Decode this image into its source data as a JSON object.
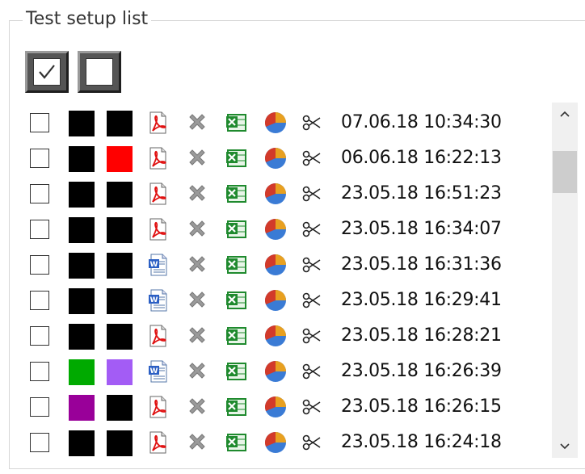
{
  "group": {
    "title": "Test setup list"
  },
  "toolbar": {
    "check_all": {
      "icon": "checkmark-icon"
    },
    "uncheck_all": {
      "icon": "empty-box-icon"
    }
  },
  "colors": {
    "black": "#000000",
    "red": "#ff0000",
    "green": "#00aa00",
    "purple": "#a35cf5",
    "magenta": "#990099"
  },
  "rows": [
    {
      "checked": false,
      "color1": "#000000",
      "color2": "#000000",
      "doc": "pdf",
      "timestamp": "07.06.18 10:34:30"
    },
    {
      "checked": false,
      "color1": "#000000",
      "color2": "#ff0000",
      "doc": "pdf",
      "timestamp": "06.06.18 16:22:13"
    },
    {
      "checked": false,
      "color1": "#000000",
      "color2": "#000000",
      "doc": "pdf",
      "timestamp": "23.05.18 16:51:23"
    },
    {
      "checked": false,
      "color1": "#000000",
      "color2": "#000000",
      "doc": "pdf",
      "timestamp": "23.05.18 16:34:07"
    },
    {
      "checked": false,
      "color1": "#000000",
      "color2": "#000000",
      "doc": "word",
      "timestamp": "23.05.18 16:31:36"
    },
    {
      "checked": false,
      "color1": "#000000",
      "color2": "#000000",
      "doc": "word",
      "timestamp": "23.05.18 16:29:41"
    },
    {
      "checked": false,
      "color1": "#000000",
      "color2": "#000000",
      "doc": "pdf",
      "timestamp": "23.05.18 16:28:21"
    },
    {
      "checked": false,
      "color1": "#00aa00",
      "color2": "#a35cf5",
      "doc": "word",
      "timestamp": "23.05.18 16:26:39"
    },
    {
      "checked": false,
      "color1": "#990099",
      "color2": "#000000",
      "doc": "pdf",
      "timestamp": "23.05.18 16:26:15"
    },
    {
      "checked": false,
      "color1": "#000000",
      "color2": "#000000",
      "doc": "pdf",
      "timestamp": "23.05.18 16:24:18"
    }
  ],
  "row_icons": [
    "delete-icon",
    "excel-icon",
    "pie-chart-icon",
    "scissors-icon"
  ],
  "scrollbar": {
    "up_icon": "chevron-up-icon",
    "down_icon": "chevron-down-icon"
  }
}
